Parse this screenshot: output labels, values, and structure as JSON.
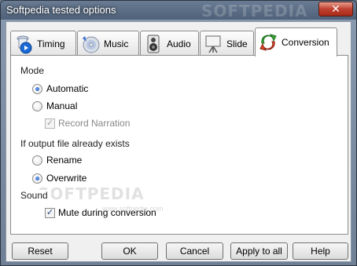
{
  "window": {
    "title": "Softpedia tested options",
    "title_watermark": "SOFTPEDIA",
    "close_label": "✕"
  },
  "tabs": [
    {
      "label": "Timing",
      "icon": "clock-icon",
      "active": false
    },
    {
      "label": "Music",
      "icon": "cd-icon",
      "active": false
    },
    {
      "label": "Audio",
      "icon": "speaker-icon",
      "active": false
    },
    {
      "label": "Slide",
      "icon": "projector-screen-icon",
      "active": false
    },
    {
      "label": "Conversion",
      "icon": "convert-arrows-icon",
      "active": true
    }
  ],
  "mode": {
    "label": "Mode",
    "options": [
      {
        "label": "Automatic",
        "selected": true
      },
      {
        "label": "Manual",
        "selected": false
      }
    ],
    "record_narration": {
      "label": "Record Narration",
      "checked": true,
      "enabled": false
    }
  },
  "output_exists": {
    "label": "If output file already exists",
    "options": [
      {
        "label": "Rename",
        "selected": false
      },
      {
        "label": "Overwrite",
        "selected": true
      }
    ]
  },
  "sound": {
    "label": "Sound",
    "mute": {
      "label": "Mute during conversion",
      "checked": true
    }
  },
  "watermark": {
    "text": "SOFTPEDIA",
    "sub": "www.softpedia.com"
  },
  "buttons": {
    "reset": "Reset",
    "ok": "OK",
    "cancel": "Cancel",
    "apply_all": "Apply to all",
    "help": "Help"
  },
  "colors": {
    "titlebar": "#5a6c84",
    "close": "#c04030",
    "radio_dot": "#1a4aa8"
  }
}
